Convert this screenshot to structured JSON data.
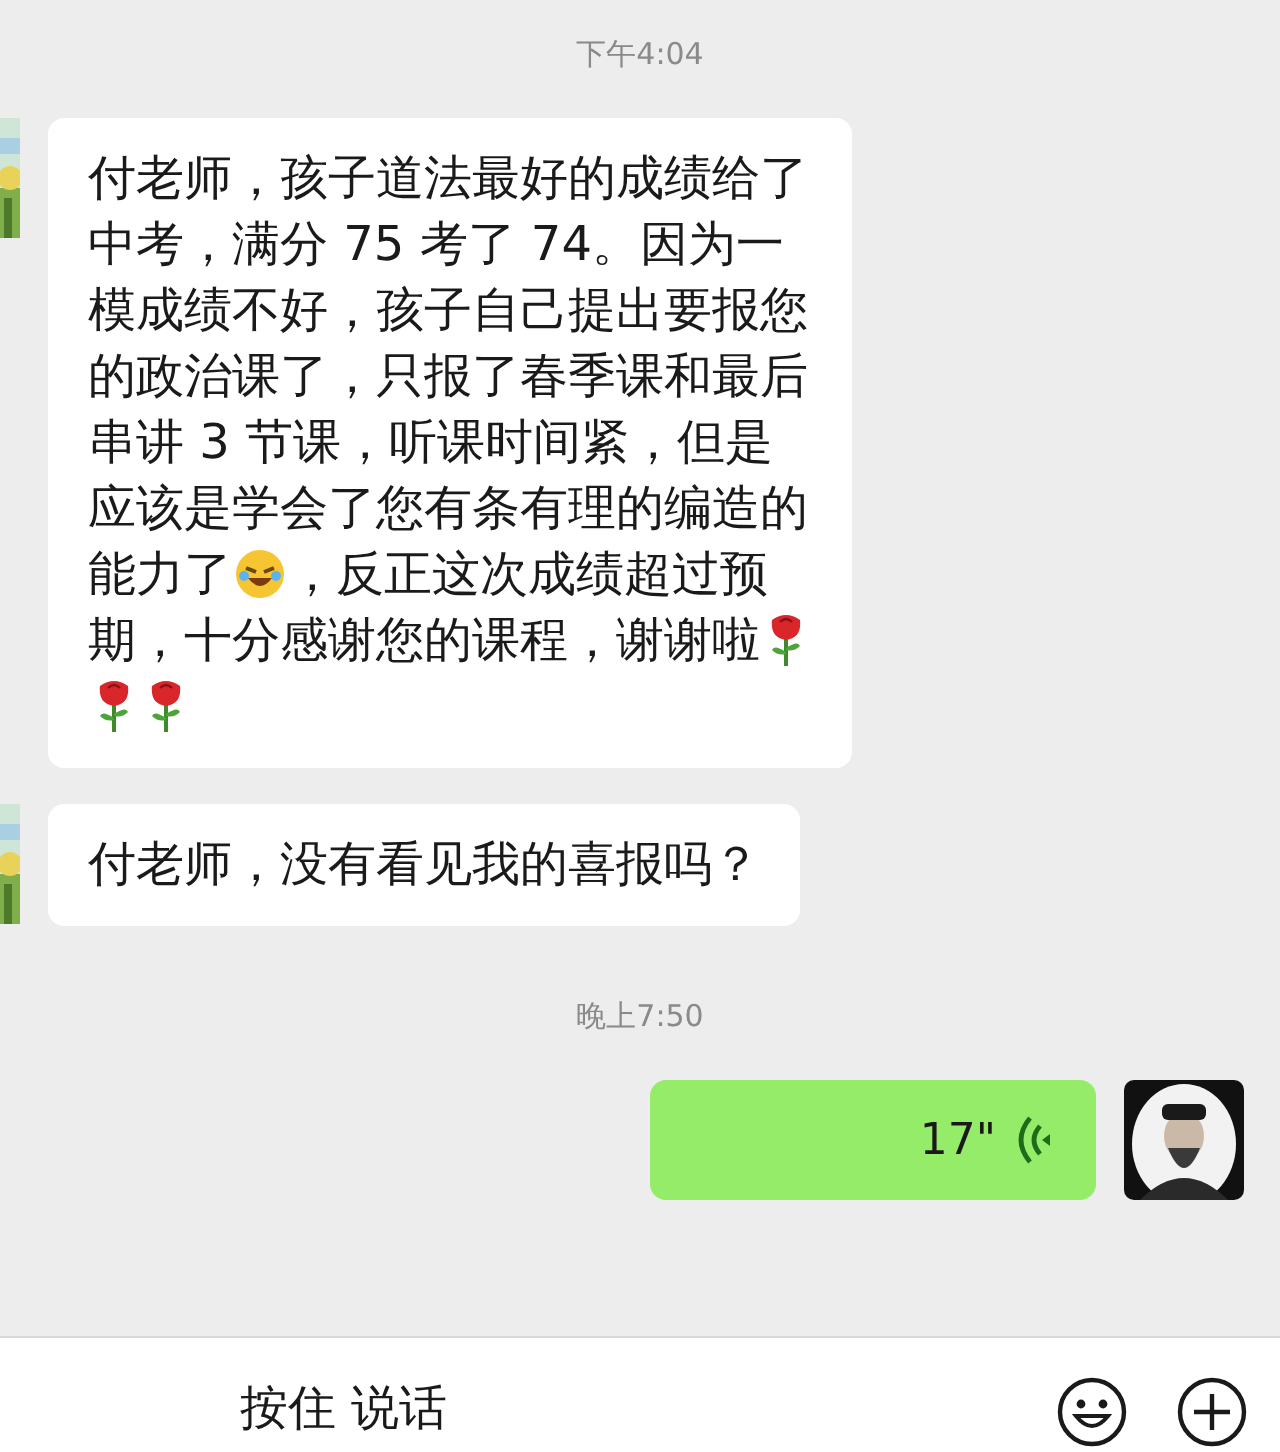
{
  "messages": [
    {
      "kind": "time",
      "text": "下午4:04"
    },
    {
      "kind": "incoming",
      "parts": [
        {
          "kind": "text",
          "text": "付老师，孩子道法最好的成绩给了中考，满分 75 考了 74。因为一模成绩不好，孩子自己提出要报您的政治课了，只报了春季课和最后串讲 3 节课，听课时间紧，但是应该是学会了您有条有理的编造的能力了"
        },
        {
          "kind": "laugh"
        },
        {
          "kind": "text",
          "text": "，反正这次成绩超过预期，十分感谢您的课程，谢谢啦"
        },
        {
          "kind": "rose"
        },
        {
          "kind": "rose"
        },
        {
          "kind": "rose"
        }
      ]
    },
    {
      "kind": "incoming",
      "parts": [
        {
          "kind": "text",
          "text": "付老师，没有看见我的喜报吗？"
        }
      ]
    },
    {
      "kind": "time",
      "text": "晚上7:50"
    },
    {
      "kind": "voice",
      "duration": "17\""
    }
  ],
  "input_bar": {
    "hold_to_talk": "按住 说话"
  }
}
